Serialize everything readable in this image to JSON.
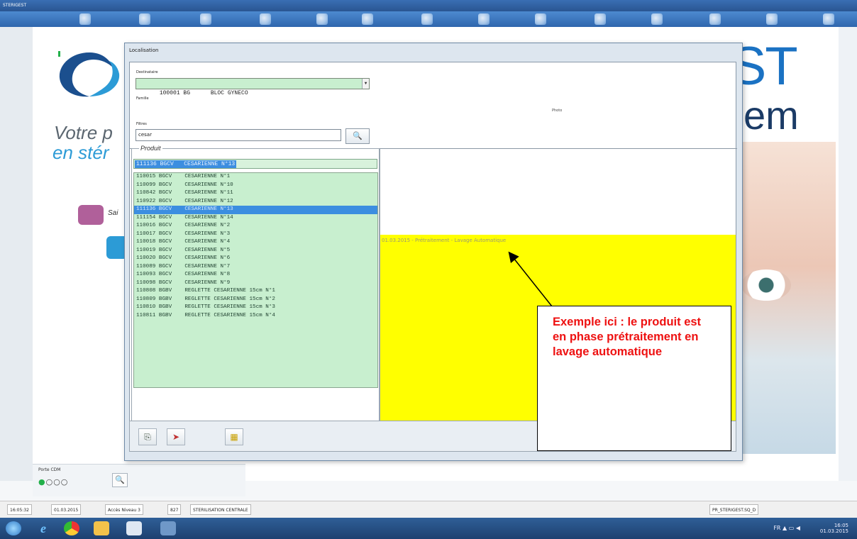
{
  "app": {
    "title": "STERIGEST",
    "brand_big": "STERIGEST",
    "brand_big2": "em",
    "tagline_1": "Votre p",
    "tagline_2": "en stér",
    "pink_label": "Sai",
    "porte_cote_label": "Porte CDM",
    "circles": "●○○○"
  },
  "dialog": {
    "title": "Localisation",
    "destinataire_label": "Destinataire",
    "destinataire_value": "100001 BG      BLOC GYNECO",
    "famille_label": "Famille",
    "photo_label": "Photo",
    "filtres_label": "Filtres",
    "filtre_value": "cesar",
    "produit_group_label": "Produit",
    "selected_product": "111136 BGCV   CESARIENNE N°13",
    "products": [
      "110015 BGCV    CESARIENNE N°1",
      "110099 BGCV    CESARIENNE N°10",
      "110842 BGCV    CESARIENNE N°11",
      "110922 BGCV    CESARIENNE N°12",
      "111136 BGCV    CESARIENNE N°13",
      "111154 BGCV    CESARIENNE N°14",
      "110016 BGCV    CESARIENNE N°2",
      "110017 BGCV    CESARIENNE N°3",
      "110018 BGCV    CESARIENNE N°4",
      "110019 BGCV    CESARIENNE N°5",
      "110020 BGCV    CESARIENNE N°6",
      "110089 BGCV    CESARIENNE N°7",
      "110093 BGCV    CESARIENNE N°8",
      "110098 BGCV    CESARIENNE N°9",
      "110808 BGBV    REGLETTE CESARIENNE 15cm N°1",
      "110809 BGBV    REGLETTE CESARIENNE 15cm N°2",
      "110810 BGBV    REGLETTE CESARIENNE 15cm N°3",
      "110811 BGBV    REGLETTE CESARIENNE 15cm N°4"
    ],
    "selected_index": 4,
    "status_text": "01.03.2015 - Prétraitement - Lavage Automatique",
    "status_color": "#ffff00"
  },
  "callout": {
    "text": "Exemple ici : le produit est en phase prétraitement en lavage automatique"
  },
  "statusbar": {
    "time": "16:05:32",
    "date": "01.03.2015",
    "access": "Accès Niveau 3",
    "code": "827",
    "service": "STERILISATION CENTRALE",
    "db": "PR_STERIGEST.SQ_D"
  },
  "taskbar": {
    "lang": "FR",
    "clock_time": "16:05",
    "clock_date": "01.03.2015"
  }
}
